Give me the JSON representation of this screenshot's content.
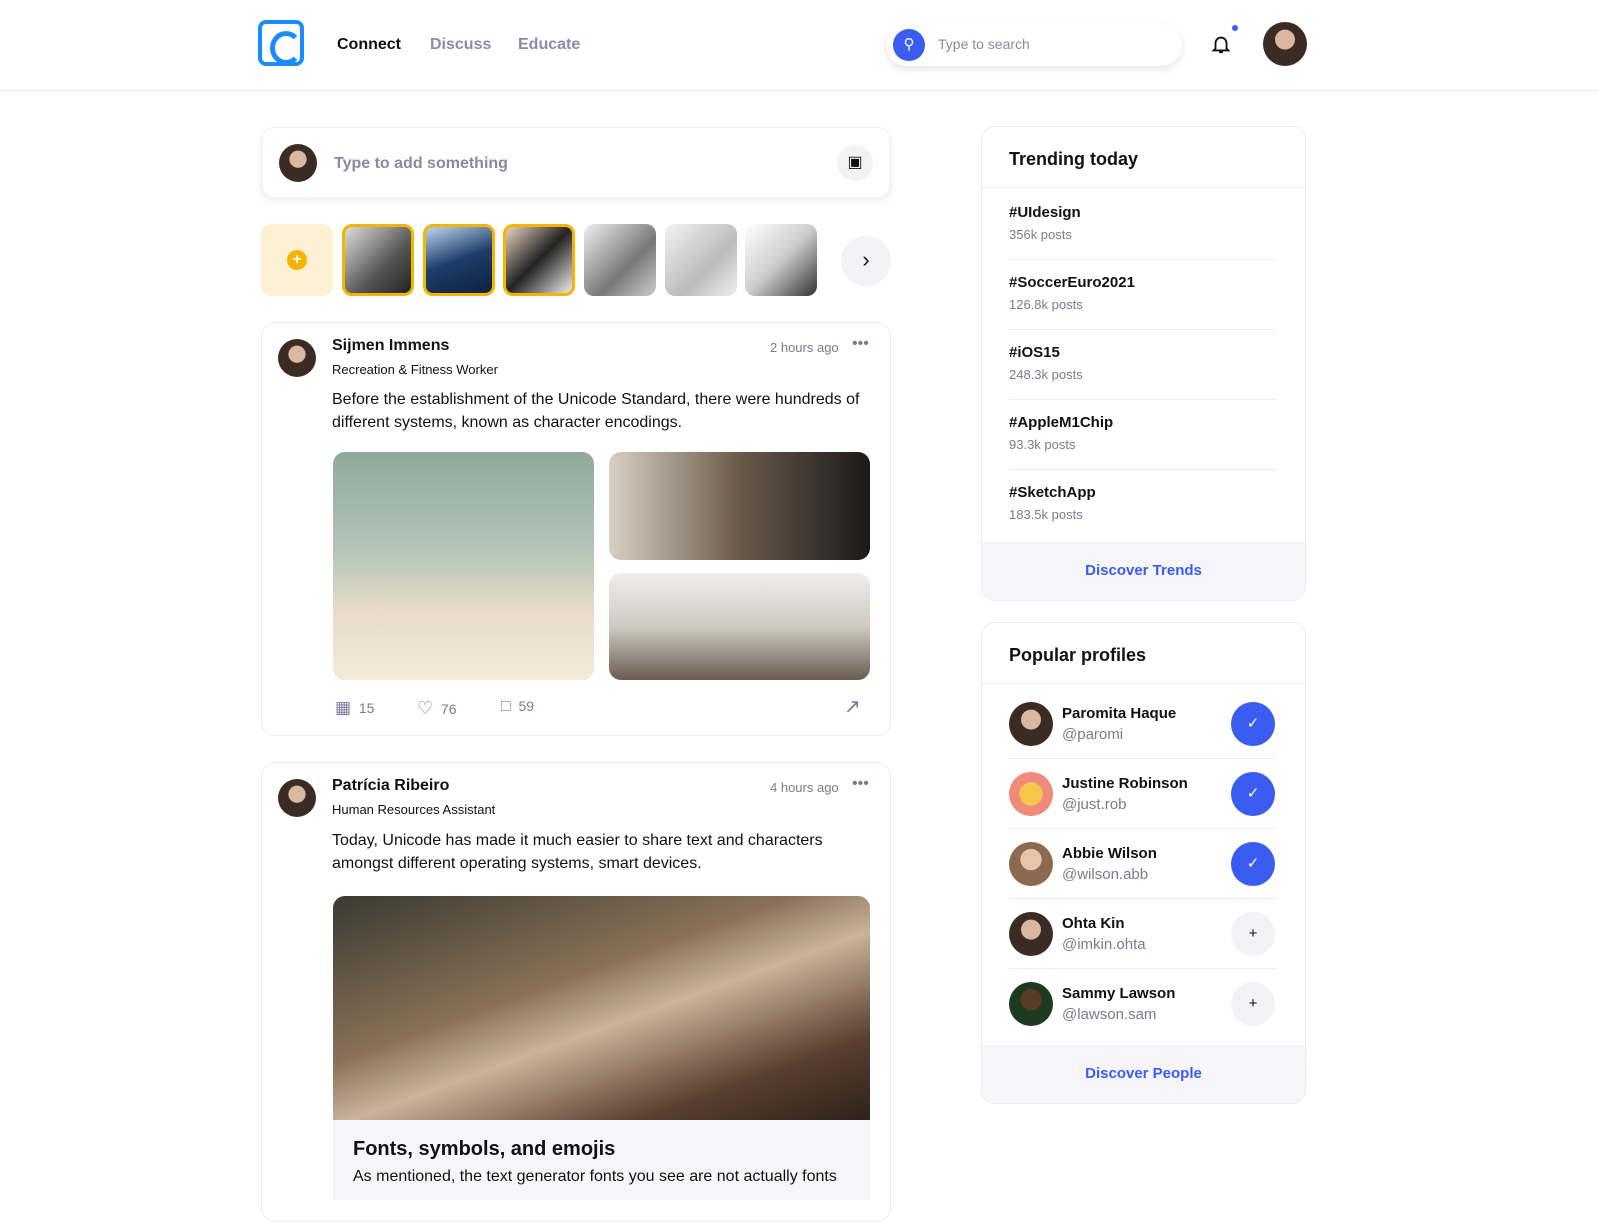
{
  "header": {
    "nav": [
      "Connect",
      "Discuss",
      "Educate"
    ],
    "search_placeholder": "Type to search"
  },
  "composer": {
    "placeholder": "Type to add something"
  },
  "posts": [
    {
      "name": "Sijmen Immens",
      "role": "Recreation & Fitness Worker",
      "time": "2 hours ago",
      "text": "Before the establishment of the Unicode Standard, there were hundreds of different systems, known as character encodings.",
      "comments": "15",
      "likes": "76",
      "saves": "59"
    },
    {
      "name": "Patrícia Ribeiro",
      "role": "Human Resources Assistant",
      "time": "4 hours ago",
      "text": "Today, Unicode has made it much easier to share text and characters amongst different operating systems, smart devices.",
      "link_title": "Fonts, symbols, and emojis",
      "link_text": "As mentioned, the text generator fonts you see are not actually fonts"
    }
  ],
  "trending": {
    "title": "Trending today",
    "items": [
      {
        "tag": "#UIdesign",
        "count": "356k posts"
      },
      {
        "tag": "#SoccerEuro2021",
        "count": "126.8k posts"
      },
      {
        "tag": "#iOS15",
        "count": "248.3k posts"
      },
      {
        "tag": "#AppleM1Chip",
        "count": "93.3k posts"
      },
      {
        "tag": "#SketchApp",
        "count": "183.5k posts"
      }
    ],
    "footer": "Discover Trends"
  },
  "profiles": {
    "title": "Popular profiles",
    "items": [
      {
        "name": "Paromita Haque",
        "handle": "@paromi",
        "following": true
      },
      {
        "name": "Justine Robinson",
        "handle": "@just.rob",
        "following": true
      },
      {
        "name": "Abbie Wilson",
        "handle": "@wilson.abb",
        "following": true
      },
      {
        "name": "Ohta Kin",
        "handle": "@imkin.ohta",
        "following": false
      },
      {
        "name": "Sammy Lawson",
        "handle": "@lawson.sam",
        "following": false
      }
    ],
    "footer": "Discover People"
  },
  "colors": {
    "accent": "#3a5cf0",
    "logo": "#1a8cff",
    "story_ring": "#f5b400"
  }
}
